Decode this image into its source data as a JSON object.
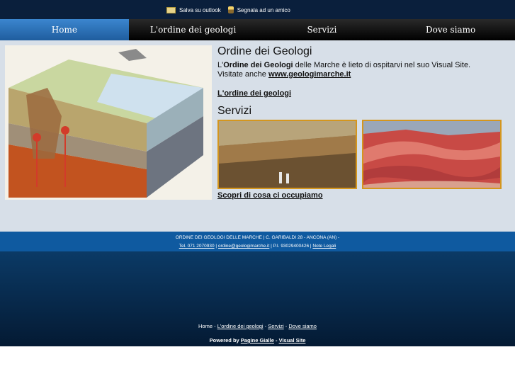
{
  "toplinks": {
    "save": "Salva su outlook",
    "share": "Segnala ad un amico"
  },
  "nav": {
    "home": "Home",
    "ordine": "L'ordine dei geologi",
    "servizi": "Servizi",
    "dove": "Dove siamo"
  },
  "main": {
    "title": "Ordine dei Geologi",
    "intro_prefix": "L'",
    "intro_bold": "Ordine dei Geologi",
    "intro_rest": " delle Marche è lieto di ospitarvi nel suo Visual Site.",
    "visit_prefix": "Visitate anche ",
    "visit_link": "www.geologimarche.it",
    "ordine_link": "L'ordine dei geologi",
    "servizi_title": "Servizi",
    "scopri_link": "Scopri di cosa ci occupiamo"
  },
  "footer": {
    "org": "ORDINE DEI GEOLOGI DELLE MARCHE | C. GARIBALDI 28 - ANCONA (AN) -",
    "tel": "Tel. 071 2070930",
    "sep1": " | ",
    "email": "ordine@geologimarche.it",
    "piva": " | P.I. 93029400426 | ",
    "note": "Note Legali"
  },
  "footer_nav": {
    "home": "Home",
    "sep": " - ",
    "ordine": "L'ordine dei geologi",
    "servizi": "Servizi",
    "dove": "Dove siamo"
  },
  "powered": {
    "label": "Powered by ",
    "pagine": "Pagine Gialle",
    "dash": " - ",
    "visual": "Visual Site"
  }
}
